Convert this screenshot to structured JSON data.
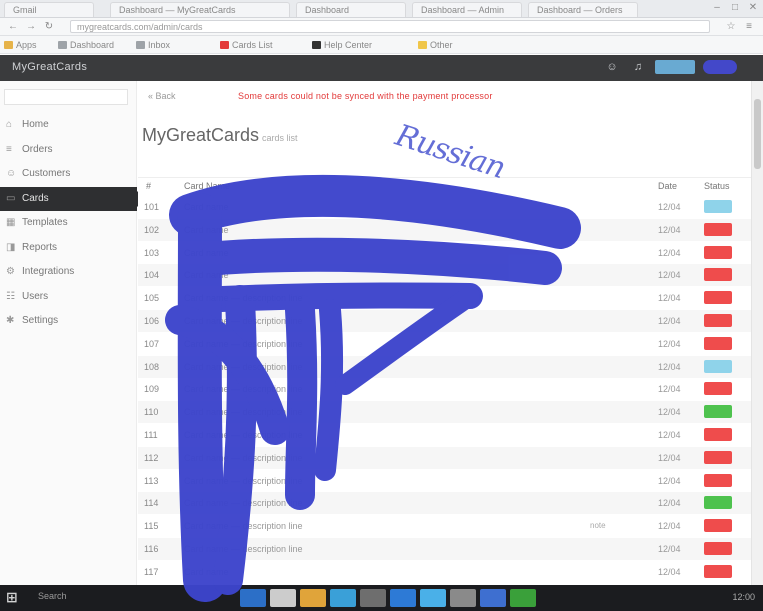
{
  "browser": {
    "tabs": [
      {
        "label": "Gmail"
      },
      {
        "label": "Dashboard — MyGreatCards"
      },
      {
        "label": "Dashboard"
      },
      {
        "label": "Dashboard — Admin"
      },
      {
        "label": "Dashboard — Orders"
      }
    ],
    "url": "mygreatcards.com/admin/cards",
    "bookmarks": [
      {
        "label": "Apps",
        "color": "#e6b34a"
      },
      {
        "label": "Dashboard",
        "color": "#9ea3a8"
      },
      {
        "label": "Inbox",
        "color": "#9ea3a8"
      },
      {
        "label": "Cards List",
        "color": "#e33a3a"
      },
      {
        "label": "Help Center",
        "color": "#333333"
      },
      {
        "label": "Other",
        "color": "#f0c64a"
      }
    ]
  },
  "header": {
    "brand": "MyGreatCards",
    "icons": [
      "user-icon",
      "bell-icon"
    ],
    "accent": "#69aad2",
    "accent2": "#4348c9"
  },
  "sidebar": {
    "items": [
      {
        "label": "Home",
        "icon": "home-icon",
        "glyph": "⌂"
      },
      {
        "label": "Orders",
        "icon": "list-icon",
        "glyph": "≡"
      },
      {
        "label": "Customers",
        "icon": "user-icon",
        "glyph": "☺"
      },
      {
        "label": "Cards",
        "icon": "card-icon",
        "glyph": "▭",
        "active": true
      },
      {
        "label": "Templates",
        "icon": "grid-icon",
        "glyph": "▦"
      },
      {
        "label": "Reports",
        "icon": "chart-icon",
        "glyph": "◨"
      },
      {
        "label": "Integrations",
        "icon": "plug-icon",
        "glyph": "⚙"
      },
      {
        "label": "Users",
        "icon": "users-icon",
        "glyph": "☷"
      },
      {
        "label": "Settings",
        "icon": "gear-icon",
        "glyph": "✱"
      }
    ]
  },
  "main": {
    "breadcrumb": "« Back",
    "alert": "Some cards could not be synced with the payment processor",
    "title": "MyGreatCards",
    "title_sub": "cards list",
    "columns": [
      "#",
      "Card Name",
      "Date",
      "Status"
    ],
    "rows": [
      {
        "id": "101",
        "name": "Card name",
        "date": "12/04",
        "status": "#8fd3ea"
      },
      {
        "id": "102",
        "name": "Card name",
        "date": "12/04",
        "status": "#ef4c4c"
      },
      {
        "id": "103",
        "name": "Card name",
        "date": "12/04",
        "status": "#ef4c4c"
      },
      {
        "id": "104",
        "name": "Card name",
        "date": "12/04",
        "status": "#ef4c4c"
      },
      {
        "id": "105",
        "name": "Card name — description line",
        "date": "12/04",
        "status": "#ef4c4c"
      },
      {
        "id": "106",
        "name": "Card name — description line",
        "date": "12/04",
        "status": "#ef4c4c"
      },
      {
        "id": "107",
        "name": "Card name — description line",
        "date": "12/04",
        "status": "#ef4c4c"
      },
      {
        "id": "108",
        "name": "Card name — description line",
        "date": "12/04",
        "status": "#8fd3ea"
      },
      {
        "id": "109",
        "name": "Card name — description line",
        "date": "12/04",
        "status": "#ef4c4c"
      },
      {
        "id": "110",
        "name": "Card name — description line",
        "date": "12/04",
        "status": "#4ec24e"
      },
      {
        "id": "111",
        "name": "Card name — description line",
        "date": "12/04",
        "status": "#ef4c4c"
      },
      {
        "id": "112",
        "name": "Card name — description line",
        "date": "12/04",
        "status": "#ef4c4c"
      },
      {
        "id": "113",
        "name": "Card name — description line",
        "date": "12/04",
        "status": "#ef4c4c"
      },
      {
        "id": "114",
        "name": "Card name — description line",
        "date": "12/04",
        "status": "#4ec24e"
      },
      {
        "id": "115",
        "name": "Card name — description line",
        "date": "12/04",
        "status": "#ef4c4c",
        "extra": "note"
      },
      {
        "id": "116",
        "name": "Card name — description line",
        "date": "12/04",
        "status": "#ef4c4c"
      },
      {
        "id": "117",
        "name": "Card name",
        "date": "12/04",
        "status": "#ef4c4c"
      }
    ]
  },
  "annotation": {
    "text": "Russian",
    "color": "#3d45cc"
  },
  "taskbar": {
    "search": "Search",
    "apps": [
      "#2c6fc7",
      "#cccccc",
      "#e0a43a",
      "#3aa0d8",
      "#6e6e6e",
      "#2d7ad6",
      "#4ab0e8",
      "#8a8a8a",
      "#3e6fd0",
      "#3aa03a"
    ],
    "tray": "12:00"
  }
}
